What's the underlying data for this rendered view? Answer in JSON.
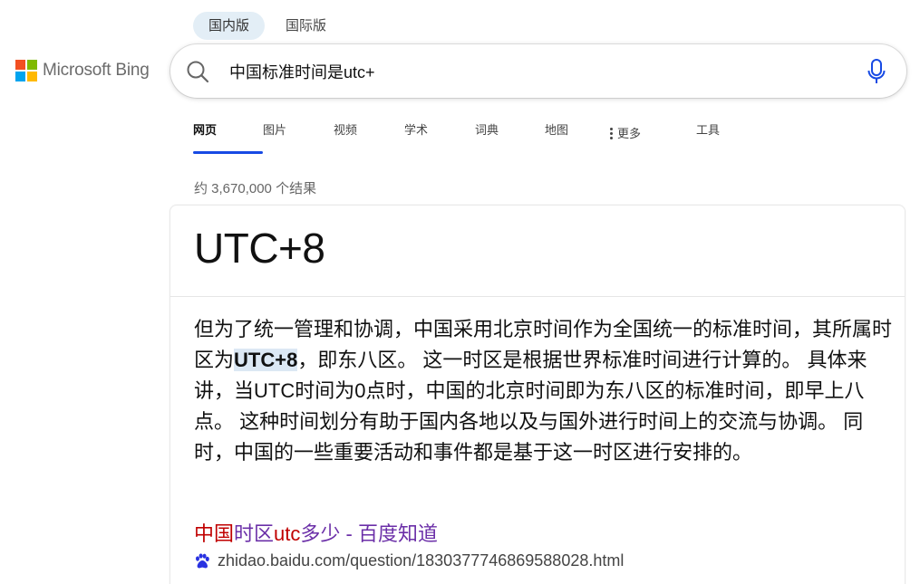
{
  "versions": {
    "domestic": "国内版",
    "international": "国际版"
  },
  "logo": {
    "text": "Microsoft Bing",
    "colors": [
      "#f25022",
      "#7fba00",
      "#00a4ef",
      "#ffb900"
    ]
  },
  "search": {
    "query": "中国标准时间是utc+",
    "icon": "search-icon",
    "mic_icon": "mic-icon",
    "mic_color": "#174ae4"
  },
  "tabs": [
    {
      "label": "网页",
      "active": true
    },
    {
      "label": "图片"
    },
    {
      "label": "视频"
    },
    {
      "label": "学术"
    },
    {
      "label": "词典"
    },
    {
      "label": "地图"
    },
    {
      "label": "更多"
    },
    {
      "label": "工具"
    }
  ],
  "results_count": "约 3,670,000 个结果",
  "answer": {
    "title": "UTC+8",
    "text_before": "但为了统一管理和协调，中国采用北京时间作为全国统一的标准时间，其所属时区为",
    "highlight": "UTC+8",
    "text_after": "，即东八区。 这一时区是根据世界标准时间进行计算的。 具体来讲，当UTC时间为0点时，中国的北京时间即为东八区的标准时间，即早上八点。 这种时间划分有助于国内各地以及与国外进行时间上的交流与协调。 同时，中国的一些重要活动和事件都是基于这一时区进行安排的。",
    "source": {
      "title_red_1": "中国",
      "title_purple_1": "时区",
      "title_red_2": "utc",
      "title_purple_2": "多少 - 百度知道",
      "url": "zhidao.baidu.com/question/1830377746869588028.html",
      "favicon": "baidu-paw-icon",
      "favicon_color": "#2932e1"
    }
  },
  "colors": {
    "accent": "#174ae4",
    "link_red": "#c00000",
    "link_purple": "#6b2fa8",
    "highlight_bg": "#dce8f4"
  }
}
